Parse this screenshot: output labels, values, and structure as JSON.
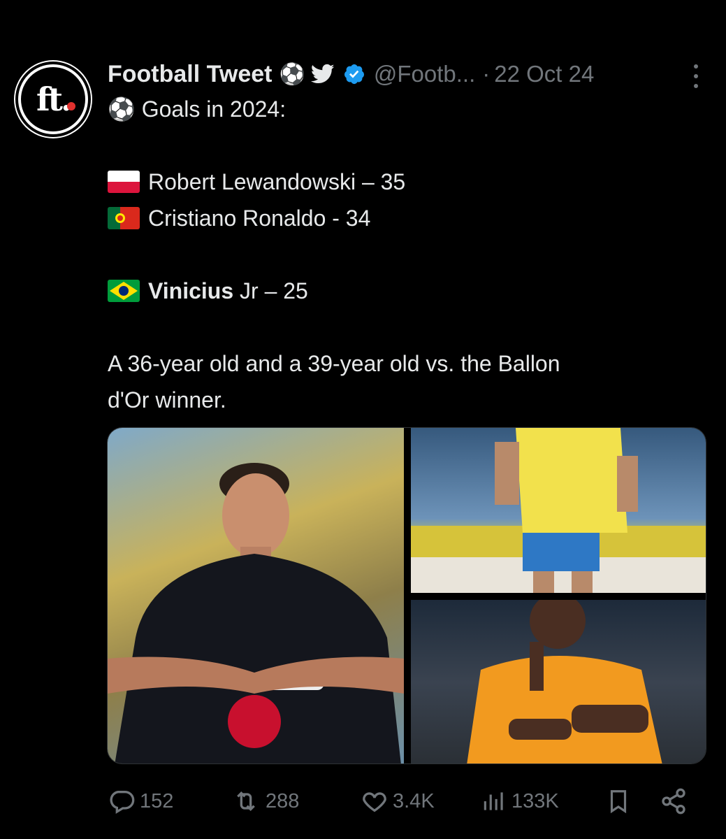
{
  "tweet": {
    "author_name": "Football Tweet",
    "name_emoji": "⚽",
    "handle": "@Footb...",
    "separator": "·",
    "date": "22 Oct 24",
    "avatar_text": "ft.",
    "lines": {
      "title": "⚽ Goals in 2024:",
      "row1": "Robert Lewandowski – 35",
      "row2": "Cristiano Ronaldo - 34",
      "row3_bold": "Vinicius",
      "row3_rest": " Jr – 25",
      "para1": "A 36-year old and a 39-year old vs. the Ballon",
      "para2": "d'Or winner."
    },
    "media_icons": [
      "poland-flag-icon",
      "portugal-flag-icon",
      "brazil-flag-icon"
    ]
  },
  "actions": {
    "replies": "152",
    "reposts": "288",
    "likes": "3.4K",
    "views": "133K"
  },
  "colors": {
    "background": "#000000",
    "text": "#e7e9ea",
    "muted": "#71767b",
    "verified": "#1d9bf0"
  }
}
